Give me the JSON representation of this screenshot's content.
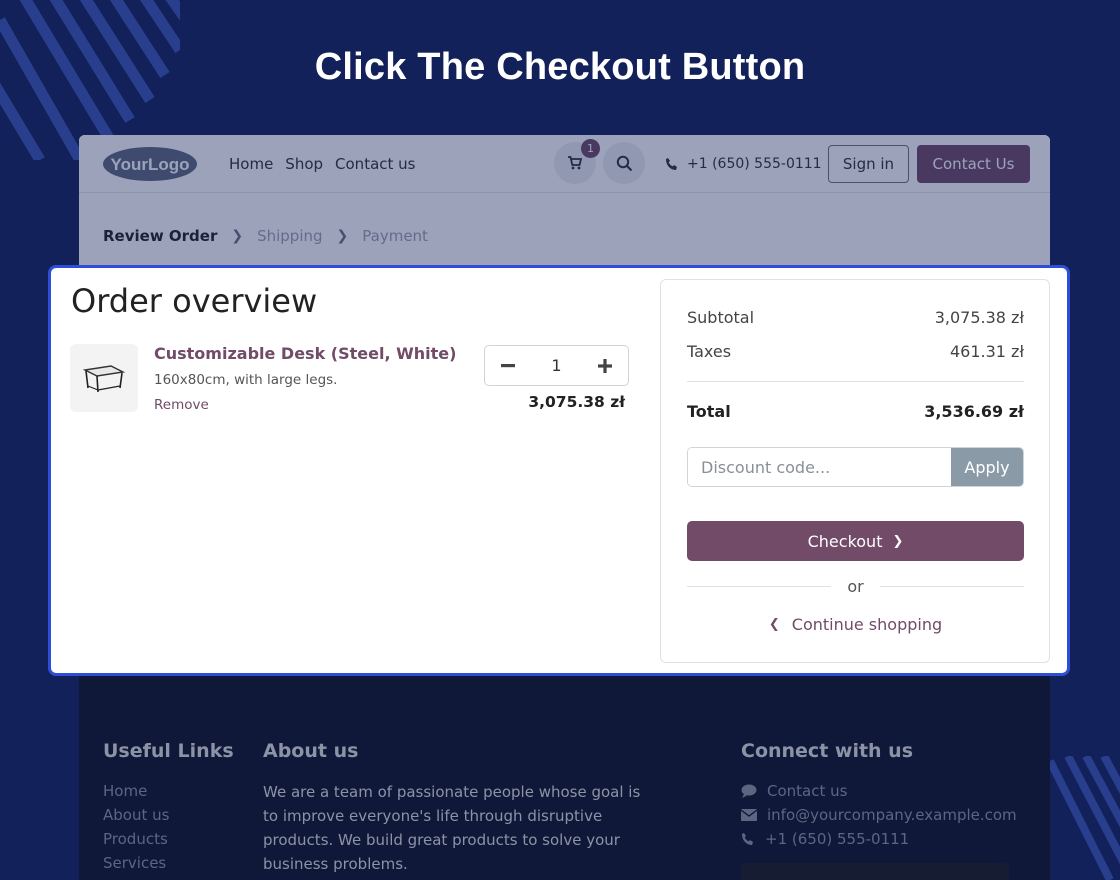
{
  "banner": {
    "title": "Click The Checkout Button"
  },
  "header": {
    "logo_text": "YourLogo",
    "nav": [
      "Home",
      "Shop",
      "Contact us"
    ],
    "cart_count": "1",
    "phone": "+1 (650) 555-0111",
    "sign_in": "Sign in",
    "contact_us": "Contact Us"
  },
  "steps": {
    "review": "Review Order",
    "shipping": "Shipping",
    "payment": "Payment"
  },
  "order": {
    "title": "Order overview",
    "product": {
      "name": "Customizable Desk (Steel, White)",
      "description": "160x80cm, with large legs.",
      "remove": "Remove",
      "quantity": "1",
      "price": "3,075.38 zł"
    }
  },
  "summary": {
    "subtotal_label": "Subtotal",
    "subtotal_value": "3,075.38 zł",
    "taxes_label": "Taxes",
    "taxes_value": "461.31 zł",
    "total_label": "Total",
    "total_value": "3,536.69 zł",
    "discount_placeholder": "Discount code...",
    "apply": "Apply",
    "checkout": "Checkout",
    "or": "or",
    "continue": "Continue shopping"
  },
  "footer": {
    "useful_links_title": "Useful Links",
    "useful_links": [
      "Home",
      "About us",
      "Products",
      "Services"
    ],
    "about_title": "About us",
    "about_text": "We are a team of passionate people whose goal is to improve everyone's life through disruptive products. We build great products to solve your business problems.",
    "connect_title": "Connect with us",
    "connect": [
      "Contact us",
      "info@yourcompany.example.com",
      "+1 (650) 555-0111"
    ]
  },
  "colors": {
    "background": "#13215a",
    "brand": "#714b67",
    "highlight_border": "#2f4ed8",
    "apply_button": "#8b9aa7"
  }
}
